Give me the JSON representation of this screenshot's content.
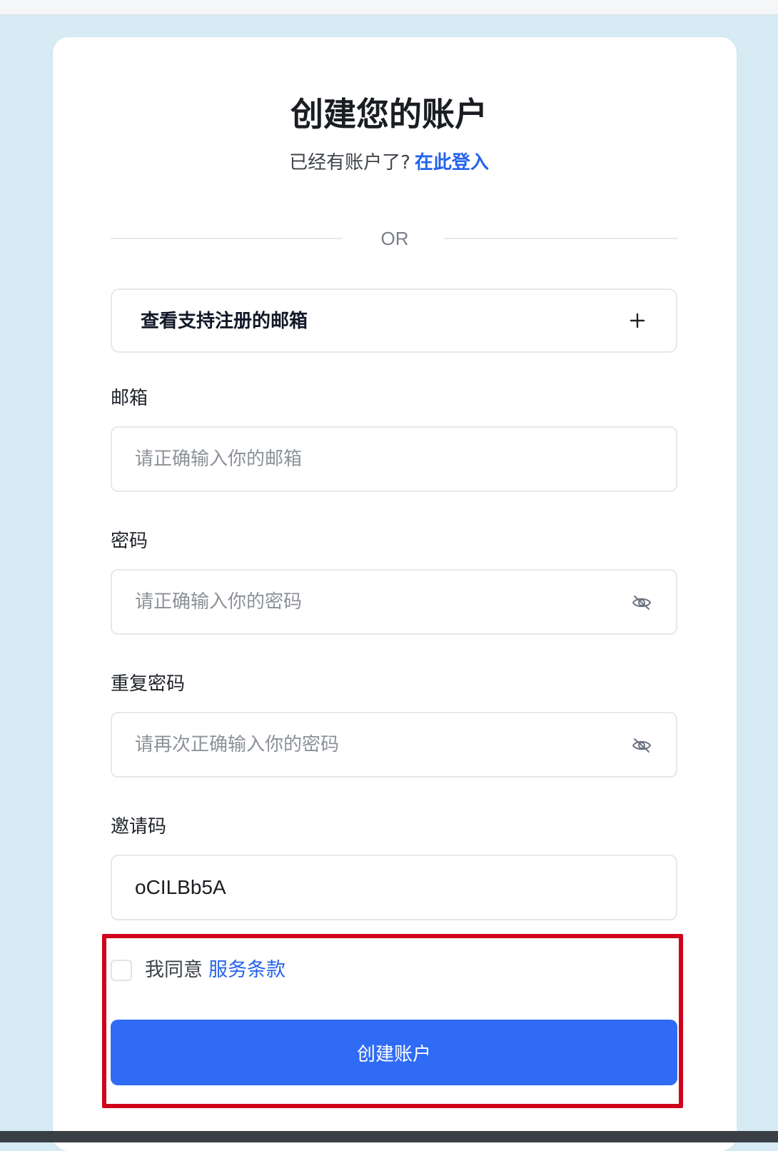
{
  "page": {
    "title": "创建您的账户",
    "subtitle_text": "已经有账户了?",
    "login_link": "在此登入",
    "divider_text": "OR"
  },
  "supported_emails": {
    "label": "查看支持注册的邮箱",
    "icon": "plus-icon"
  },
  "form": {
    "email": {
      "label": "邮箱",
      "placeholder": "请正确输入你的邮箱",
      "value": ""
    },
    "password": {
      "label": "密码",
      "placeholder": "请正确输入你的密码",
      "value": "",
      "icon": "eye-off-icon"
    },
    "confirm_password": {
      "label": "重复密码",
      "placeholder": "请再次正确输入你的密码",
      "value": "",
      "icon": "eye-off-icon"
    },
    "invite_code": {
      "label": "邀请码",
      "placeholder": "",
      "value": "oCILBb5A"
    },
    "agree_text": "我同意",
    "terms_link": "服务条款",
    "terms_checked": false,
    "submit_label": "创建账户"
  },
  "colors": {
    "background": "#d6ebf3",
    "card": "#ffffff",
    "accent": "#2f6bf5",
    "link": "#2563eb",
    "highlight": "#d0021b"
  }
}
